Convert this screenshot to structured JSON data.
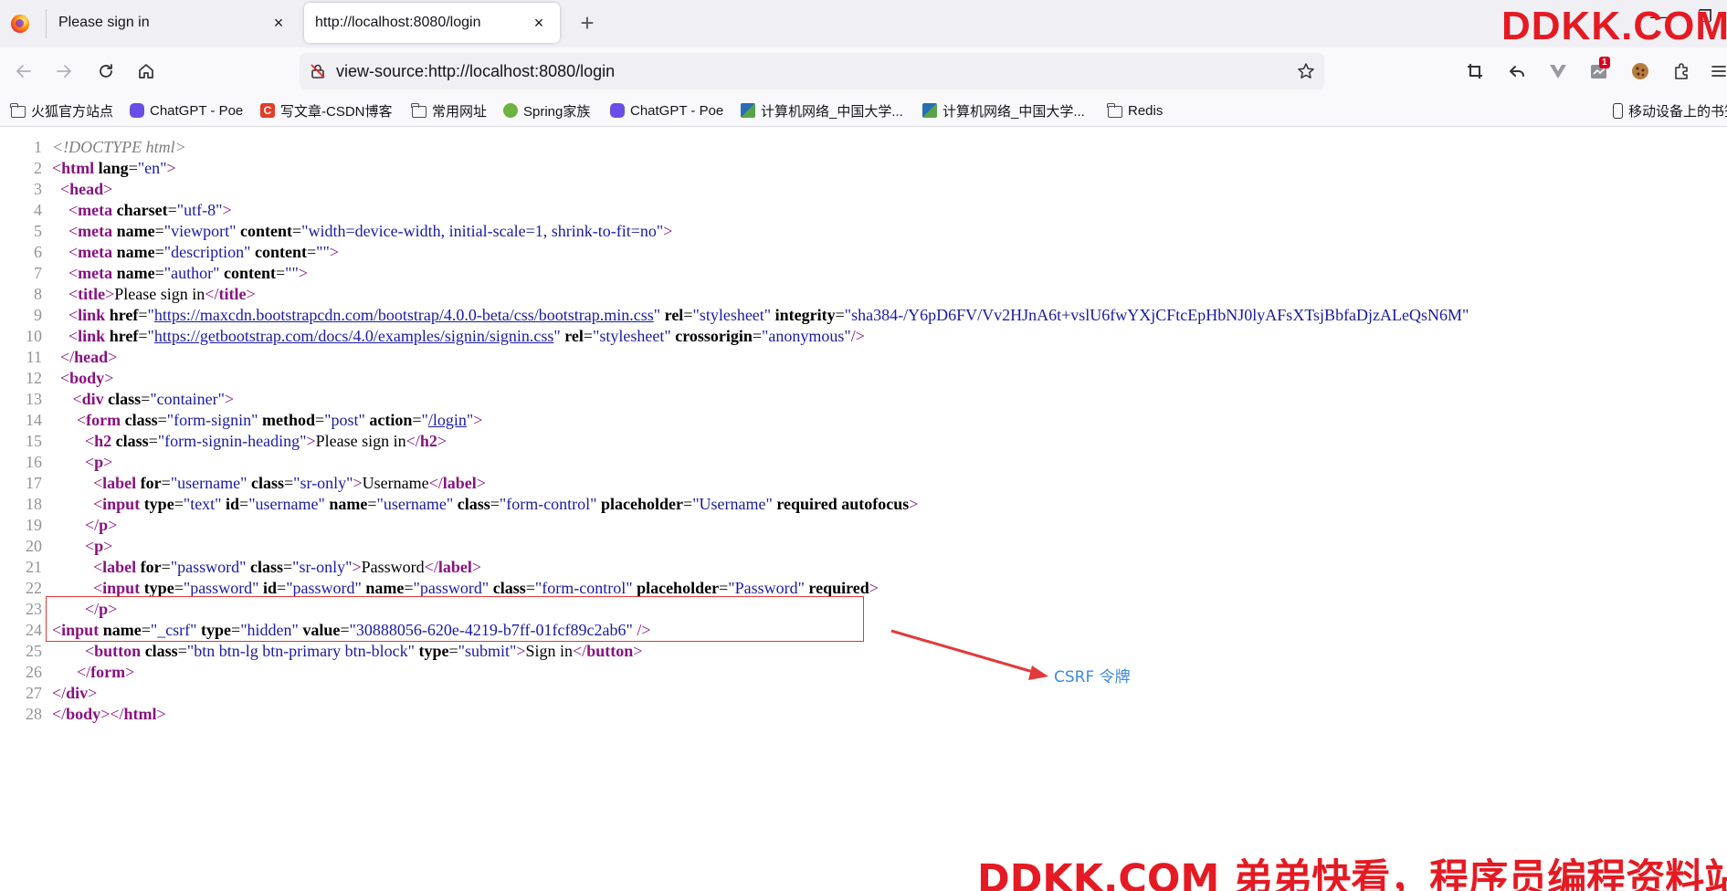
{
  "tabs": [
    {
      "title": "Please sign in",
      "close": "×"
    },
    {
      "title": "http://localhost:8080/login",
      "close": "×"
    }
  ],
  "new_tab": "+",
  "window_controls": [
    "—",
    "❐"
  ],
  "url": "view-source:http://localhost:8080/login",
  "extensions": {
    "badge": "1"
  },
  "bookmarks": [
    {
      "label": "火狐官方站点",
      "icon": "folder-icon"
    },
    {
      "label": "ChatGPT - Poe",
      "icon": "poe-icon"
    },
    {
      "label": "写文章-CSDN博客",
      "icon": "csdn-icon"
    },
    {
      "label": "常用网址",
      "icon": "folder-icon"
    },
    {
      "label": "Spring家族",
      "icon": "spring-icon"
    },
    {
      "label": "ChatGPT - Poe",
      "icon": "poe-icon"
    },
    {
      "label": "计算机网络_中国大学...",
      "icon": "mooc-icon"
    },
    {
      "label": "计算机网络_中国大学...",
      "icon": "mooc-icon"
    },
    {
      "label": "Redis",
      "icon": "folder-icon"
    },
    {
      "label": "移动设备上的书签",
      "icon": "mobile-icon"
    }
  ],
  "source_lines": [
    {
      "n": "1",
      "html": "<span class='cmt'>&lt;!DOCTYPE html&gt;</span>"
    },
    {
      "n": "2",
      "html": "<span class='brk'>&lt;</span><span class='tag'>html</span> <span class='attr'>lang</span>=<span class='val'>\"en\"</span><span class='brk'>&gt;</span>"
    },
    {
      "n": "3",
      "html": "  <span class='brk'>&lt;</span><span class='tag'>head</span><span class='brk'>&gt;</span>"
    },
    {
      "n": "4",
      "html": "    <span class='brk'>&lt;</span><span class='tag'>meta</span> <span class='attr'>charset</span>=<span class='val'>\"utf-8\"</span><span class='brk'>&gt;</span>"
    },
    {
      "n": "5",
      "html": "    <span class='brk'>&lt;</span><span class='tag'>meta</span> <span class='attr'>name</span>=<span class='val'>\"viewport\"</span> <span class='attr'>content</span>=<span class='val'>\"width=device-width, initial-scale=1, shrink-to-fit=no\"</span><span class='brk'>&gt;</span>"
    },
    {
      "n": "6",
      "html": "    <span class='brk'>&lt;</span><span class='tag'>meta</span> <span class='attr'>name</span>=<span class='val'>\"description\"</span> <span class='attr'>content</span>=<span class='val'>\"\"</span><span class='brk'>&gt;</span>"
    },
    {
      "n": "7",
      "html": "    <span class='brk'>&lt;</span><span class='tag'>meta</span> <span class='attr'>name</span>=<span class='val'>\"author\"</span> <span class='attr'>content</span>=<span class='val'>\"\"</span><span class='brk'>&gt;</span>"
    },
    {
      "n": "8",
      "html": "    <span class='brk'>&lt;</span><span class='tag'>title</span><span class='brk'>&gt;</span>Please sign in<span class='brk'>&lt;/</span><span class='tag'>title</span><span class='brk'>&gt;</span>"
    },
    {
      "n": "9",
      "html": "    <span class='brk'>&lt;</span><span class='tag'>link</span> <span class='attr'>href</span>=<span class='val'>\"</span><span class='link'>https://maxcdn.bootstrapcdn.com/bootstrap/4.0.0-beta/css/bootstrap.min.css</span><span class='val'>\"</span> <span class='attr'>rel</span>=<span class='val'>\"stylesheet\"</span> <span class='attr'>integrity</span>=<span class='val'>\"sha384-/Y6pD6FV/Vv2HJnA6t+vslU6fwYXjCFtcEpHbNJ0lyAFsXTsjBbfaDjzALeQsN6M\"</span>"
    },
    {
      "n": "10",
      "html": "    <span class='brk'>&lt;</span><span class='tag'>link</span> <span class='attr'>href</span>=<span class='val'>\"</span><span class='link'>https://getbootstrap.com/docs/4.0/examples/signin/signin.css</span><span class='val'>\"</span> <span class='attr'>rel</span>=<span class='val'>\"stylesheet\"</span> <span class='attr'>crossorigin</span>=<span class='val'>\"anonymous\"</span><span class='brk'>/&gt;</span>"
    },
    {
      "n": "11",
      "html": "  <span class='brk'>&lt;/</span><span class='tag'>head</span><span class='brk'>&gt;</span>"
    },
    {
      "n": "12",
      "html": "  <span class='brk'>&lt;</span><span class='tag'>body</span><span class='brk'>&gt;</span>"
    },
    {
      "n": "13",
      "html": "     <span class='brk'>&lt;</span><span class='tag'>div</span> <span class='attr'>class</span>=<span class='val'>\"container\"</span><span class='brk'>&gt;</span>"
    },
    {
      "n": "14",
      "html": "      <span class='brk'>&lt;</span><span class='tag'>form</span> <span class='attr'>class</span>=<span class='val'>\"form-signin\"</span> <span class='attr'>method</span>=<span class='val'>\"post\"</span> <span class='attr'>action</span>=<span class='val'>\"</span><span class='link'>/login</span><span class='val'>\"</span><span class='brk'>&gt;</span>"
    },
    {
      "n": "15",
      "html": "        <span class='brk'>&lt;</span><span class='tag'>h2</span> <span class='attr'>class</span>=<span class='val'>\"form-signin-heading\"</span><span class='brk'>&gt;</span>Please sign in<span class='brk'>&lt;/</span><span class='tag'>h2</span><span class='brk'>&gt;</span>"
    },
    {
      "n": "16",
      "html": "        <span class='brk'>&lt;</span><span class='tag'>p</span><span class='brk'>&gt;</span>"
    },
    {
      "n": "17",
      "html": "          <span class='brk'>&lt;</span><span class='tag'>label</span> <span class='attr'>for</span>=<span class='val'>\"username\"</span> <span class='attr'>class</span>=<span class='val'>\"sr-only\"</span><span class='brk'>&gt;</span>Username<span class='brk'>&lt;/</span><span class='tag'>label</span><span class='brk'>&gt;</span>"
    },
    {
      "n": "18",
      "html": "          <span class='brk'>&lt;</span><span class='tag'>input</span> <span class='attr'>type</span>=<span class='val'>\"text\"</span> <span class='attr'>id</span>=<span class='val'>\"username\"</span> <span class='attr'>name</span>=<span class='val'>\"username\"</span> <span class='attr'>class</span>=<span class='val'>\"form-control\"</span> <span class='attr'>placeholder</span>=<span class='val'>\"Username\"</span> <span class='attr'>required</span> <span class='attr'>autofocus</span><span class='brk'>&gt;</span>"
    },
    {
      "n": "19",
      "html": "        <span class='brk'>&lt;/</span><span class='tag'>p</span><span class='brk'>&gt;</span>"
    },
    {
      "n": "20",
      "html": "        <span class='brk'>&lt;</span><span class='tag'>p</span><span class='brk'>&gt;</span>"
    },
    {
      "n": "21",
      "html": "          <span class='brk'>&lt;</span><span class='tag'>label</span> <span class='attr'>for</span>=<span class='val'>\"password\"</span> <span class='attr'>class</span>=<span class='val'>\"sr-only\"</span><span class='brk'>&gt;</span>Password<span class='brk'>&lt;/</span><span class='tag'>label</span><span class='brk'>&gt;</span>"
    },
    {
      "n": "22",
      "html": "          <span class='brk'>&lt;</span><span class='tag'>input</span> <span class='attr'>type</span>=<span class='val'>\"password\"</span> <span class='attr'>id</span>=<span class='val'>\"password\"</span> <span class='attr'>name</span>=<span class='val'>\"password\"</span> <span class='attr'>class</span>=<span class='val'>\"form-control\"</span> <span class='attr'>placeholder</span>=<span class='val'>\"Password\"</span> <span class='attr'>required</span><span class='brk'>&gt;</span>"
    },
    {
      "n": "23",
      "html": "        <span class='brk'>&lt;/</span><span class='tag'>p</span><span class='brk'>&gt;</span>"
    },
    {
      "n": "24",
      "html": "<span class='brk'>&lt;</span><span class='tag'>input</span> <span class='attr'>name</span>=<span class='val'>\"_csrf\"</span> <span class='attr'>type</span>=<span class='val'>\"hidden\"</span> <span class='attr'>value</span>=<span class='val'>\"30888056-620e-4219-b7ff-01fcf89c2ab6\"</span> <span class='brk'>/&gt;</span>"
    },
    {
      "n": "25",
      "html": "        <span class='brk'>&lt;</span><span class='tag'>button</span> <span class='attr'>class</span>=<span class='val'>\"btn btn-lg btn-primary btn-block\"</span> <span class='attr'>type</span>=<span class='val'>\"submit\"</span><span class='brk'>&gt;</span>Sign in<span class='brk'>&lt;/</span><span class='tag'>button</span><span class='brk'>&gt;</span>"
    },
    {
      "n": "26",
      "html": "      <span class='brk'>&lt;/</span><span class='tag'>form</span><span class='brk'>&gt;</span>"
    },
    {
      "n": "27",
      "html": "<span class='brk'>&lt;/</span><span class='tag'>div</span><span class='brk'>&gt;</span>"
    },
    {
      "n": "28",
      "html": "<span class='brk'>&lt;/</span><span class='tag'>body</span><span class='brk'>&gt;&lt;/</span><span class='tag'>html</span><span class='brk'>&gt;</span>"
    }
  ],
  "annotation": {
    "label": "CSRF 令牌",
    "color": "#e23a3a",
    "label_color": "#3c8ae0"
  },
  "watermarks": {
    "top": "DDKK.COM",
    "bottom": "DDKK.COM 弟弟快看，程序员编程资料站"
  }
}
